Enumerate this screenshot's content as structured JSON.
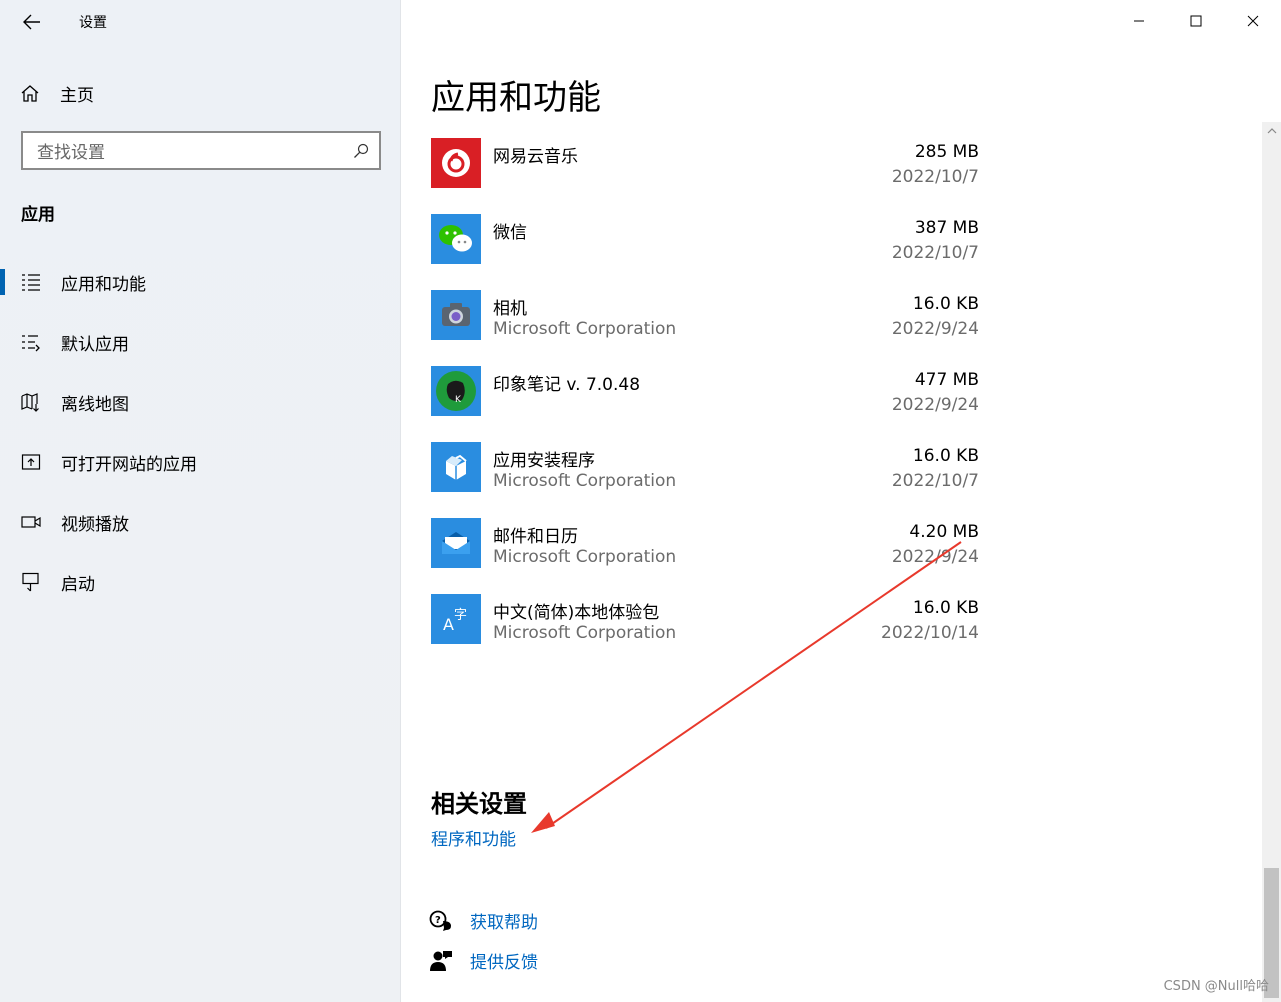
{
  "window": {
    "title": "设置"
  },
  "sidebar": {
    "home_label": "主页",
    "search_placeholder": "查找设置",
    "section_title": "应用",
    "items": [
      {
        "label": "应用和功能",
        "icon": "apps-list-icon",
        "active": true
      },
      {
        "label": "默认应用",
        "icon": "default-apps-icon",
        "active": false
      },
      {
        "label": "离线地图",
        "icon": "offline-map-icon",
        "active": false
      },
      {
        "label": "可打开网站的应用",
        "icon": "apps-for-websites-icon",
        "active": false
      },
      {
        "label": "视频播放",
        "icon": "video-icon",
        "active": false
      },
      {
        "label": "启动",
        "icon": "startup-icon",
        "active": false
      }
    ]
  },
  "main": {
    "title": "应用和功能",
    "apps": [
      {
        "name": "网易云音乐",
        "publisher": "",
        "size": "285 MB",
        "date": "2022/10/7",
        "icon": "netease-music-icon",
        "icon_color": "#d91f25"
      },
      {
        "name": "微信",
        "publisher": "",
        "size": "387 MB",
        "date": "2022/10/7",
        "icon": "wechat-icon",
        "icon_color": "#2a8de0"
      },
      {
        "name": "相机",
        "publisher": "Microsoft Corporation",
        "size": "16.0 KB",
        "date": "2022/9/24",
        "icon": "camera-icon",
        "icon_color": "#2a8de0"
      },
      {
        "name": "印象笔记 v. 7.0.48",
        "publisher": "",
        "size": "477 MB",
        "date": "2022/9/24",
        "icon": "evernote-icon",
        "icon_color": "#2a8de0"
      },
      {
        "name": "应用安装程序",
        "publisher": "Microsoft Corporation",
        "size": "16.0 KB",
        "date": "2022/10/7",
        "icon": "app-installer-icon",
        "icon_color": "#2a8de0"
      },
      {
        "name": "邮件和日历",
        "publisher": "Microsoft Corporation",
        "size": "4.20 MB",
        "date": "2022/9/24",
        "icon": "mail-icon",
        "icon_color": "#2a8de0"
      },
      {
        "name": "中文(简体)本地体验包",
        "publisher": "Microsoft Corporation",
        "size": "16.0 KB",
        "date": "2022/10/14",
        "icon": "language-pack-icon",
        "icon_color": "#2a8de0"
      }
    ],
    "related": {
      "title": "相关设置",
      "link": "程序和功能"
    },
    "help": [
      {
        "label": "获取帮助",
        "icon": "help-chat-icon"
      },
      {
        "label": "提供反馈",
        "icon": "feedback-icon"
      }
    ]
  },
  "watermark": "CSDN @Null哈哈"
}
